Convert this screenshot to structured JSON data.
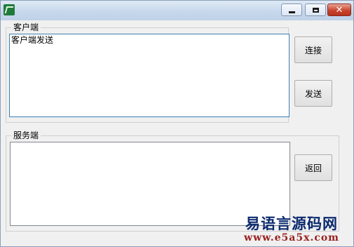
{
  "window": {
    "icon": "app-icon",
    "controls": {
      "minimize": "minimize-icon",
      "maximize": "maximize-icon",
      "close": "close-icon",
      "close_glyph": "✕"
    }
  },
  "client_group": {
    "label": "客户端",
    "textbox_value": "客户端发送",
    "connect_label": "连接",
    "send_label": "发送"
  },
  "server_group": {
    "label": "服务端",
    "textbox_value": "",
    "return_label": "返回"
  },
  "watermark": {
    "title": "易语言源码网",
    "url": "www.e5a5x.com"
  }
}
